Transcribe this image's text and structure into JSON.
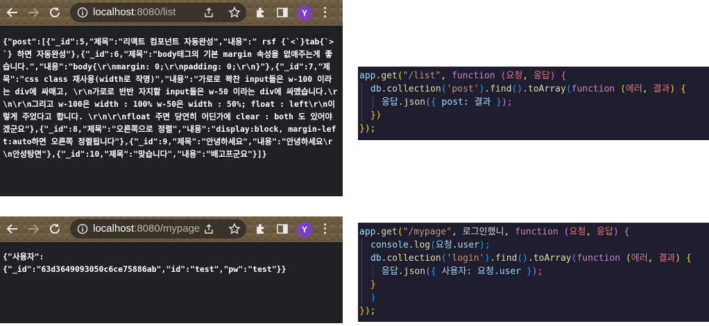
{
  "browser_list": {
    "url_host": "localhost",
    "url_rest": ":8080/list",
    "avatar_letter": "Y",
    "body": "{\"post\":[{\"_id\":5,\"제목\":\"리액트 컴포넌트 자동완성\",\"내용\":\" rsf {`<`}tab{`>`} 하면 자동완성\"},{\"_id\":6,\"제목\":\"body태그의 기본 margin 속성을 없애주는게 좋습니다.\",\"내용\":\"body{\\r\\nmargin: 0;\\r\\npadding: 0;\\r\\n}\"},{\"_id\":7,\"제목\":\"css class 재사용(width로 작명)\",\"내용\":\"가로로 꽉찬 input들은 w-100 이라는 div에 싸매고, \\r\\n가로로 반반 자지할 input들은 w-50 이라는 div에 싸맸습니다.\\r\\n\\r\\n그리고 w-100은 width : 100% w-50은 width : 50%; float : left\\r\\n이렇게 주었다고 합니다. \\r\\n\\r\\nfloat 주면 당연히 어딘가에 clear : both 도 있어야겠군요\"},{\"_id\":8,\"제목\":\"오른쪽으로 정렬\",\"내용\":\"display:block, margin-left:auto하면 오른쪽 정렬됩니다\"},{\"_id\":9,\"제목\":\"안녕하세요\",\"내용\":\"안녕하세요\\r\\n안성탕면\"},{\"_id\":10,\"제목\":\"맞습니다\",\"내용\":\"배고프군요\"}]}"
  },
  "browser_mypage": {
    "url_host": "localhost",
    "url_rest": ":8080/mypage",
    "avatar_letter": "Y",
    "body": "{\"사용자\":\n{\"_id\":\"63d3649093050c6ce75886ab\",\"id\":\"test\",\"pw\":\"test\"}}"
  },
  "code_list": {
    "l1": {
      "obj": "app",
      "dot": ".",
      "fn": "get",
      "p1": "(",
      "path": "\"/list\"",
      "comma": ", ",
      "kw": "function ",
      "p2": "(",
      "a1": "요청",
      "sep": ", ",
      "a2": "응답",
      "p3": ")",
      "sp": " ",
      "b": "{"
    },
    "l2": {
      "obj": "db",
      "dot1": ".",
      "fn1": "collection",
      "p1": "(",
      "str": "'post'",
      "p1c": ")",
      "dot2": ".",
      "fn2": "find",
      "p2": "()",
      "dot3": ".",
      "fn3": "toArray",
      "p3": "(",
      "kw": "function ",
      "p4": "(",
      "a1": "에러",
      "sep": ", ",
      "a2": "결과",
      "p4c": ")",
      "sp": " ",
      "b": "{"
    },
    "l3": {
      "obj": "응답",
      "dot": ".",
      "fn": "json",
      "p": "(",
      "b": "{",
      "rest": " post: 결과 ",
      "bc": "}",
      "pc": ");"
    },
    "l4": {
      "b": "})"
    },
    "l5": {
      "b": "});"
    }
  },
  "code_mypage": {
    "l1": {
      "obj": "app",
      "dot": ".",
      "fn": "get",
      "p1": "(",
      "path": "\"/mypage\"",
      "mid": ", 로그인했니, ",
      "kw": "function ",
      "p2": "(",
      "a1": "요청",
      "sep": ", ",
      "a2": "응답",
      "p3": ")",
      "sp": " ",
      "b": "{"
    },
    "l2": {
      "obj": "console",
      "dot1": ".",
      "fn": "log",
      "p": "(",
      "arg": "요청.user",
      "pc": ");"
    },
    "l3": {
      "obj": "db",
      "dot1": ".",
      "fn1": "collection",
      "p1": "(",
      "str": "'login'",
      "p1c": ")",
      "dot2": ".",
      "fn2": "find",
      "p2": "()",
      "dot3": ".",
      "fn3": "toArray",
      "p3": "(",
      "kw": "function ",
      "p4": "(",
      "a1": "에러",
      "sep": ", ",
      "a2": "결과",
      "p4c": ")",
      "sp": " ",
      "b": "{"
    },
    "l4": {
      "obj": "응답",
      "dot": ".",
      "fn": "json",
      "p": "(",
      "b": "{",
      "rest": " 사용자: 요청.user ",
      "bc": "}",
      "pc": ");"
    },
    "l5": {
      "b": "}"
    },
    "l6": {
      "b": ")"
    },
    "l7": {
      "b": "});"
    }
  }
}
